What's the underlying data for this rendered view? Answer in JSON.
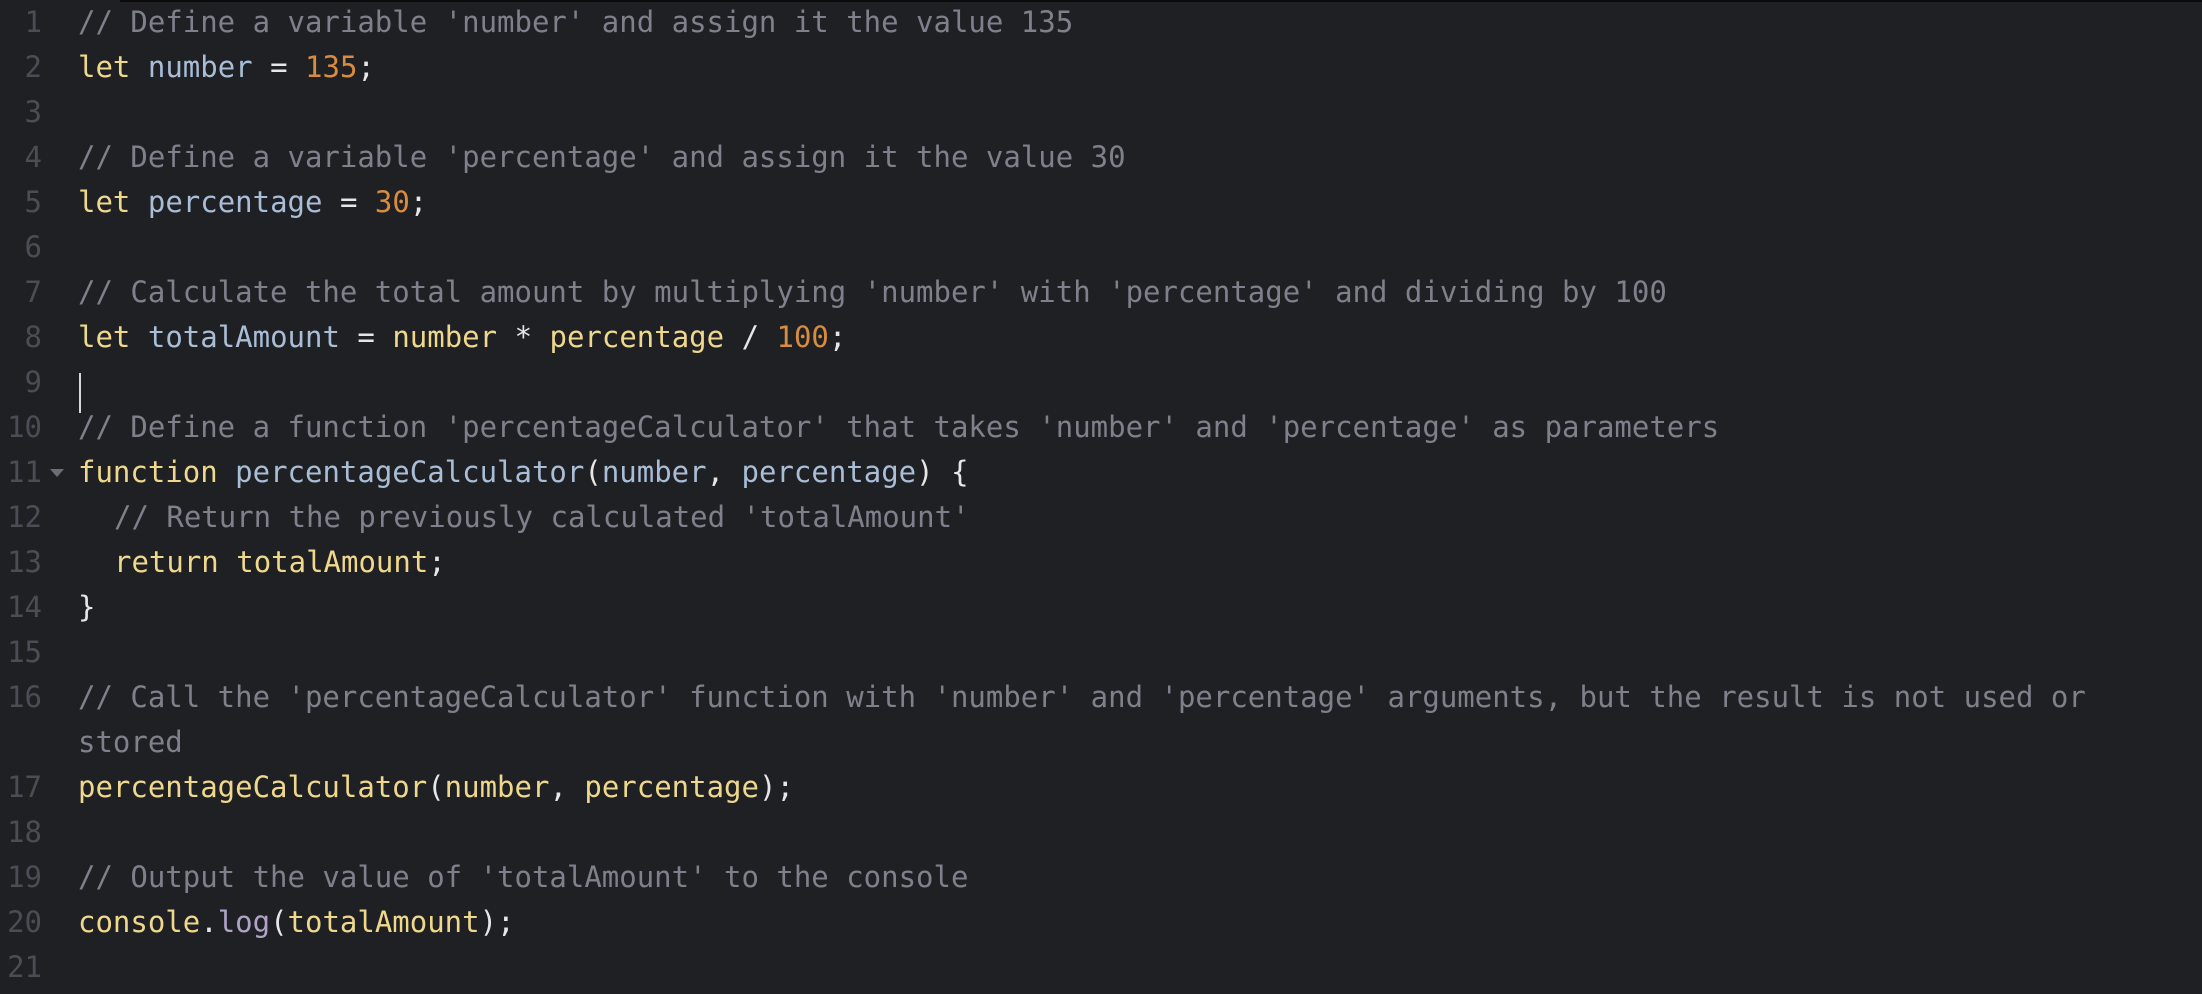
{
  "editor": {
    "line_numbers": [
      "1",
      "2",
      "3",
      "4",
      "5",
      "6",
      "7",
      "8",
      "9",
      "10",
      "11",
      "12",
      "13",
      "14",
      "15",
      "16",
      "17",
      "18",
      "19",
      "20",
      "21"
    ],
    "lines": {
      "l1": {
        "comment": "// Define a variable 'number' and assign it the value 135"
      },
      "l2": {
        "kw": "let",
        "var": "number",
        "op": "=",
        "num": "135",
        "end": ";"
      },
      "l4": {
        "comment": "// Define a variable 'percentage' and assign it the value 30"
      },
      "l5": {
        "kw": "let",
        "var": "percentage",
        "op": "=",
        "num": "30",
        "end": ";"
      },
      "l7": {
        "comment": "// Calculate the total amount by multiplying 'number' with 'percentage' and dividing by 100"
      },
      "l8": {
        "kw": "let",
        "var": "totalAmount",
        "op": "=",
        "a": "number",
        "mul": "*",
        "b": "percentage",
        "div": "/",
        "num": "100",
        "end": ";"
      },
      "l10": {
        "comment": "// Define a function 'percentageCalculator' that takes 'number' and 'percentage' as parameters"
      },
      "l11": {
        "kw": "function",
        "name": "percentageCalculator",
        "open": "(",
        "p1": "number",
        "comma": ",",
        "p2": "percentage",
        "close": ")",
        "brace": "{"
      },
      "l12": {
        "comment": "// Return the previously calculated 'totalAmount'"
      },
      "l13": {
        "kw": "return",
        "val": "totalAmount",
        "end": ";"
      },
      "l14": {
        "brace": "}"
      },
      "l16": {
        "comment": "// Call the 'percentageCalculator' function with 'number' and 'percentage' arguments, but the result is not used or",
        "comment_wrap": "stored"
      },
      "l17": {
        "name": "percentageCalculator",
        "open": "(",
        "a": "number",
        "comma": ",",
        "b": "percentage",
        "close": ")",
        "end": ";"
      },
      "l19": {
        "comment": "// Output the value of 'totalAmount' to the console"
      },
      "l20": {
        "obj": "console",
        "dot": ".",
        "meth": "log",
        "open": "(",
        "arg": "totalAmount",
        "close": ")",
        "end": ";"
      }
    }
  },
  "colors": {
    "background": "#1f2024",
    "comment": "#7e818b",
    "keyword": "#efd88c",
    "variable": "#a9bdd6",
    "number": "#d98c3f",
    "line_number": "#4b4d54"
  }
}
